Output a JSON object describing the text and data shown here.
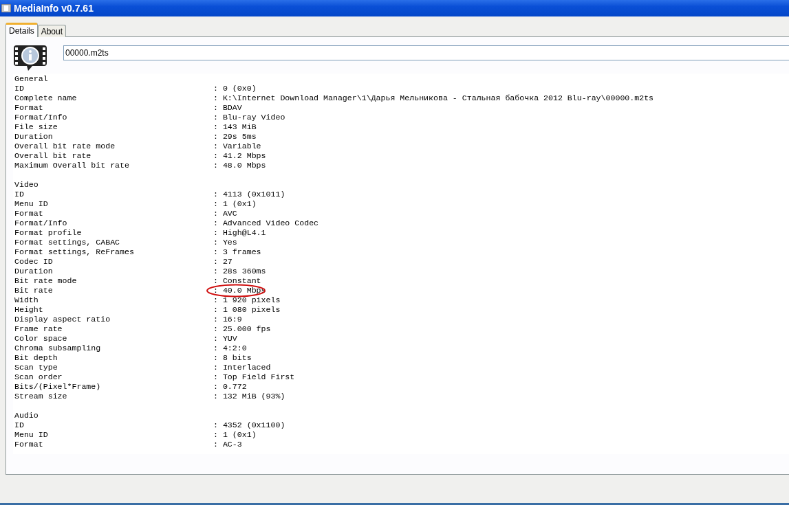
{
  "window": {
    "title": "MediaInfo v0.7.61"
  },
  "tabs": [
    {
      "label": "Details",
      "selected": true
    },
    {
      "label": "About",
      "selected": false
    }
  ],
  "file_field": {
    "value": "00000.m2ts"
  },
  "sections": [
    {
      "title": "General",
      "rows": [
        {
          "label": "ID",
          "value": ": 0 (0x0)",
          "circled": false
        },
        {
          "label": "Complete name",
          "value": ": K:\\Internet Download Manager\\1\\Дарья Мельникова - Стальная бабочка 2012 Blu-ray\\00000.m2ts",
          "circled": false
        },
        {
          "label": "Format",
          "value": ": BDAV",
          "circled": false
        },
        {
          "label": "Format/Info",
          "value": ": Blu-ray Video",
          "circled": false
        },
        {
          "label": "File size",
          "value": ": 143 MiB",
          "circled": false
        },
        {
          "label": "Duration",
          "value": ": 29s 5ms",
          "circled": false
        },
        {
          "label": "Overall bit rate mode",
          "value": ": Variable",
          "circled": false
        },
        {
          "label": "Overall bit rate",
          "value": ": 41.2 Mbps",
          "circled": false
        },
        {
          "label": "Maximum Overall bit rate",
          "value": ": 48.0 Mbps",
          "circled": false
        }
      ]
    },
    {
      "title": "Video",
      "rows": [
        {
          "label": "ID",
          "value": ": 4113 (0x1011)",
          "circled": false
        },
        {
          "label": "Menu ID",
          "value": ": 1 (0x1)",
          "circled": false
        },
        {
          "label": "Format",
          "value": ": AVC",
          "circled": false
        },
        {
          "label": "Format/Info",
          "value": ": Advanced Video Codec",
          "circled": false
        },
        {
          "label": "Format profile",
          "value": ": High@L4.1",
          "circled": false
        },
        {
          "label": "Format settings, CABAC",
          "value": ": Yes",
          "circled": false
        },
        {
          "label": "Format settings, ReFrames",
          "value": ": 3 frames",
          "circled": false
        },
        {
          "label": "Codec ID",
          "value": ": 27",
          "circled": false
        },
        {
          "label": "Duration",
          "value": ": 28s 360ms",
          "circled": false
        },
        {
          "label": "Bit rate mode",
          "value": ": Constant",
          "circled": false
        },
        {
          "label": "Bit rate",
          "value": ": 40.0 Mbps",
          "circled": true
        },
        {
          "label": "Width",
          "value": ": 1 920 pixels",
          "circled": false
        },
        {
          "label": "Height",
          "value": ": 1 080 pixels",
          "circled": false
        },
        {
          "label": "Display aspect ratio",
          "value": ": 16:9",
          "circled": false
        },
        {
          "label": "Frame rate",
          "value": ": 25.000 fps",
          "circled": false
        },
        {
          "label": "Color space",
          "value": ": YUV",
          "circled": false
        },
        {
          "label": "Chroma subsampling",
          "value": ": 4:2:0",
          "circled": false
        },
        {
          "label": "Bit depth",
          "value": ": 8 bits",
          "circled": false
        },
        {
          "label": "Scan type",
          "value": ": Interlaced",
          "circled": false
        },
        {
          "label": "Scan order",
          "value": ": Top Field First",
          "circled": false
        },
        {
          "label": "Bits/(Pixel*Frame)",
          "value": ": 0.772",
          "circled": false
        },
        {
          "label": "Stream size",
          "value": ": 132 MiB (93%)",
          "circled": false
        }
      ]
    },
    {
      "title": "Audio",
      "rows": [
        {
          "label": "ID",
          "value": ": 4352 (0x1100)",
          "circled": false
        },
        {
          "label": "Menu ID",
          "value": ": 1 (0x1)",
          "circled": false
        },
        {
          "label": "Format",
          "value": ": AC-3",
          "circled": false
        }
      ]
    }
  ]
}
